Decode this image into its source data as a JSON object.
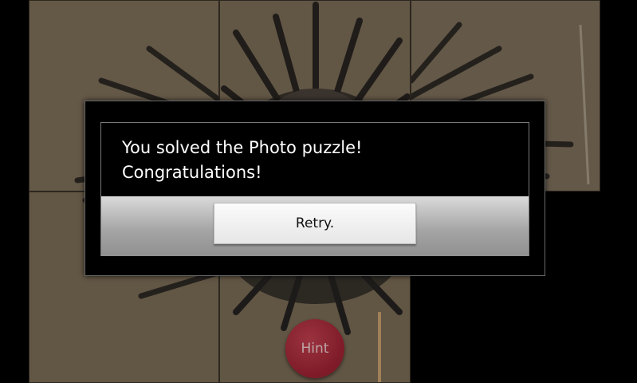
{
  "app": {
    "background_color": "#000000",
    "tile_color": "#7c6d58"
  },
  "dialog": {
    "message_line1": "You solved the Photo puzzle!",
    "message_line2": "Congratulations!",
    "retry_label": "Retry."
  },
  "hint": {
    "label": "Hint",
    "color": "#b3303f"
  }
}
